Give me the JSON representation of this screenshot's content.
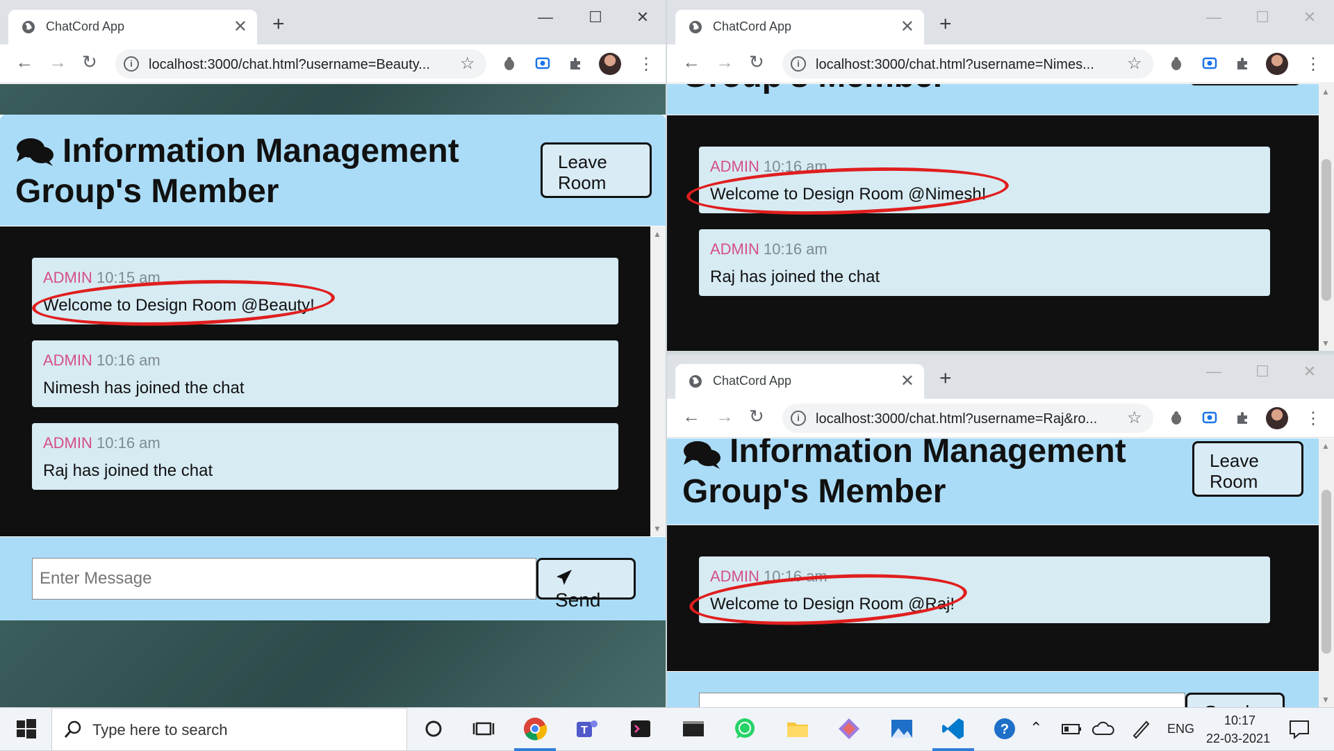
{
  "browser": {
    "tab_title": "ChatCord App",
    "tab_close": "✕",
    "new_tab": "+",
    "controls": {
      "minimize": "—",
      "maximize": "☐",
      "close": "✕"
    },
    "url_beauty": "localhost:3000/chat.html?username=Beauty...",
    "url_nimesh": "localhost:3000/chat.html?username=Nimes...",
    "url_raj": "localhost:3000/chat.html?username=Raj&ro..."
  },
  "chat": {
    "title_line1": "Information Management",
    "title_line2": "Group's Member",
    "title_partial": "Group's Member",
    "leave_label_1": "Leave",
    "leave_label_2": "Room",
    "input_placeholder": "Enter Message",
    "send_label": "Send",
    "input_partial": "Enter Message",
    "send_partial": "Send"
  },
  "windows": {
    "beauty": {
      "messages": [
        {
          "author": "ADMIN",
          "time": "10:15 am",
          "text": "Welcome to Design Room @Beauty!"
        },
        {
          "author": "ADMIN",
          "time": "10:16 am",
          "text": "Nimesh has joined the chat"
        },
        {
          "author": "ADMIN",
          "time": "10:16 am",
          "text": "Raj has joined the chat"
        }
      ]
    },
    "nimesh": {
      "messages": [
        {
          "author": "ADMIN",
          "time": "10:16 am",
          "text": "Welcome to Design Room @Nimesh!"
        },
        {
          "author": "ADMIN",
          "time": "10:16 am",
          "text": "Raj has joined the chat"
        }
      ]
    },
    "raj": {
      "messages": [
        {
          "author": "ADMIN",
          "time": "10:16 am",
          "text": "Welcome to Design Room @Raj!"
        }
      ]
    }
  },
  "taskbar": {
    "search_placeholder": "Type here to search",
    "language": "ENG",
    "time": "10:17",
    "date": "22-03-2021"
  },
  "colors": {
    "header": "#aadcf7",
    "admin": "#d54f88",
    "highlight": "#e01e1e"
  }
}
